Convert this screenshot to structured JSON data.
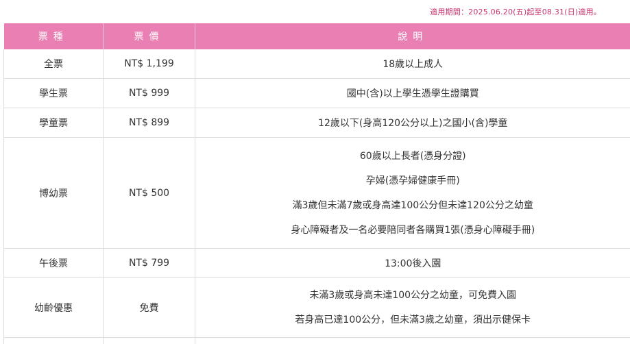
{
  "notice": "適用期間：2025.06.20(五)起至08.31(日)適用。",
  "headers": {
    "ticket_type": "票種",
    "price": "票價",
    "description": "說明"
  },
  "rows": [
    {
      "type": "全票",
      "price": "NT$ 1,199",
      "desc": [
        "18歲以上成人"
      ]
    },
    {
      "type": "學生票",
      "price": "NT$ 999",
      "desc": [
        "國中(含)以上學生憑學生證購買"
      ]
    },
    {
      "type": "學童票",
      "price": "NT$ 899",
      "desc": [
        "12歲以下(身高120公分以上)之國小(含)學童"
      ]
    },
    {
      "type": "博幼票",
      "price": "NT$ 500",
      "desc": [
        "60歲以上長者(憑身分證)",
        "孕婦(憑孕婦健康手冊)",
        "滿3歲但未滿7歲或身高達100公分但未達120公分之幼童",
        "身心障礙者及一名必要陪同者各購買1張(憑身心障礙手冊)"
      ]
    },
    {
      "type": "午後票",
      "price": "NT$ 799",
      "desc": [
        "13:00後入園"
      ]
    },
    {
      "type": "幼齡優惠",
      "price": "免費",
      "desc": [
        "未滿3歲或身高未達100公分之幼童，可免費入園",
        "若身高已達100公分，但未滿3歲之幼童，須出示健保卡"
      ]
    }
  ]
}
